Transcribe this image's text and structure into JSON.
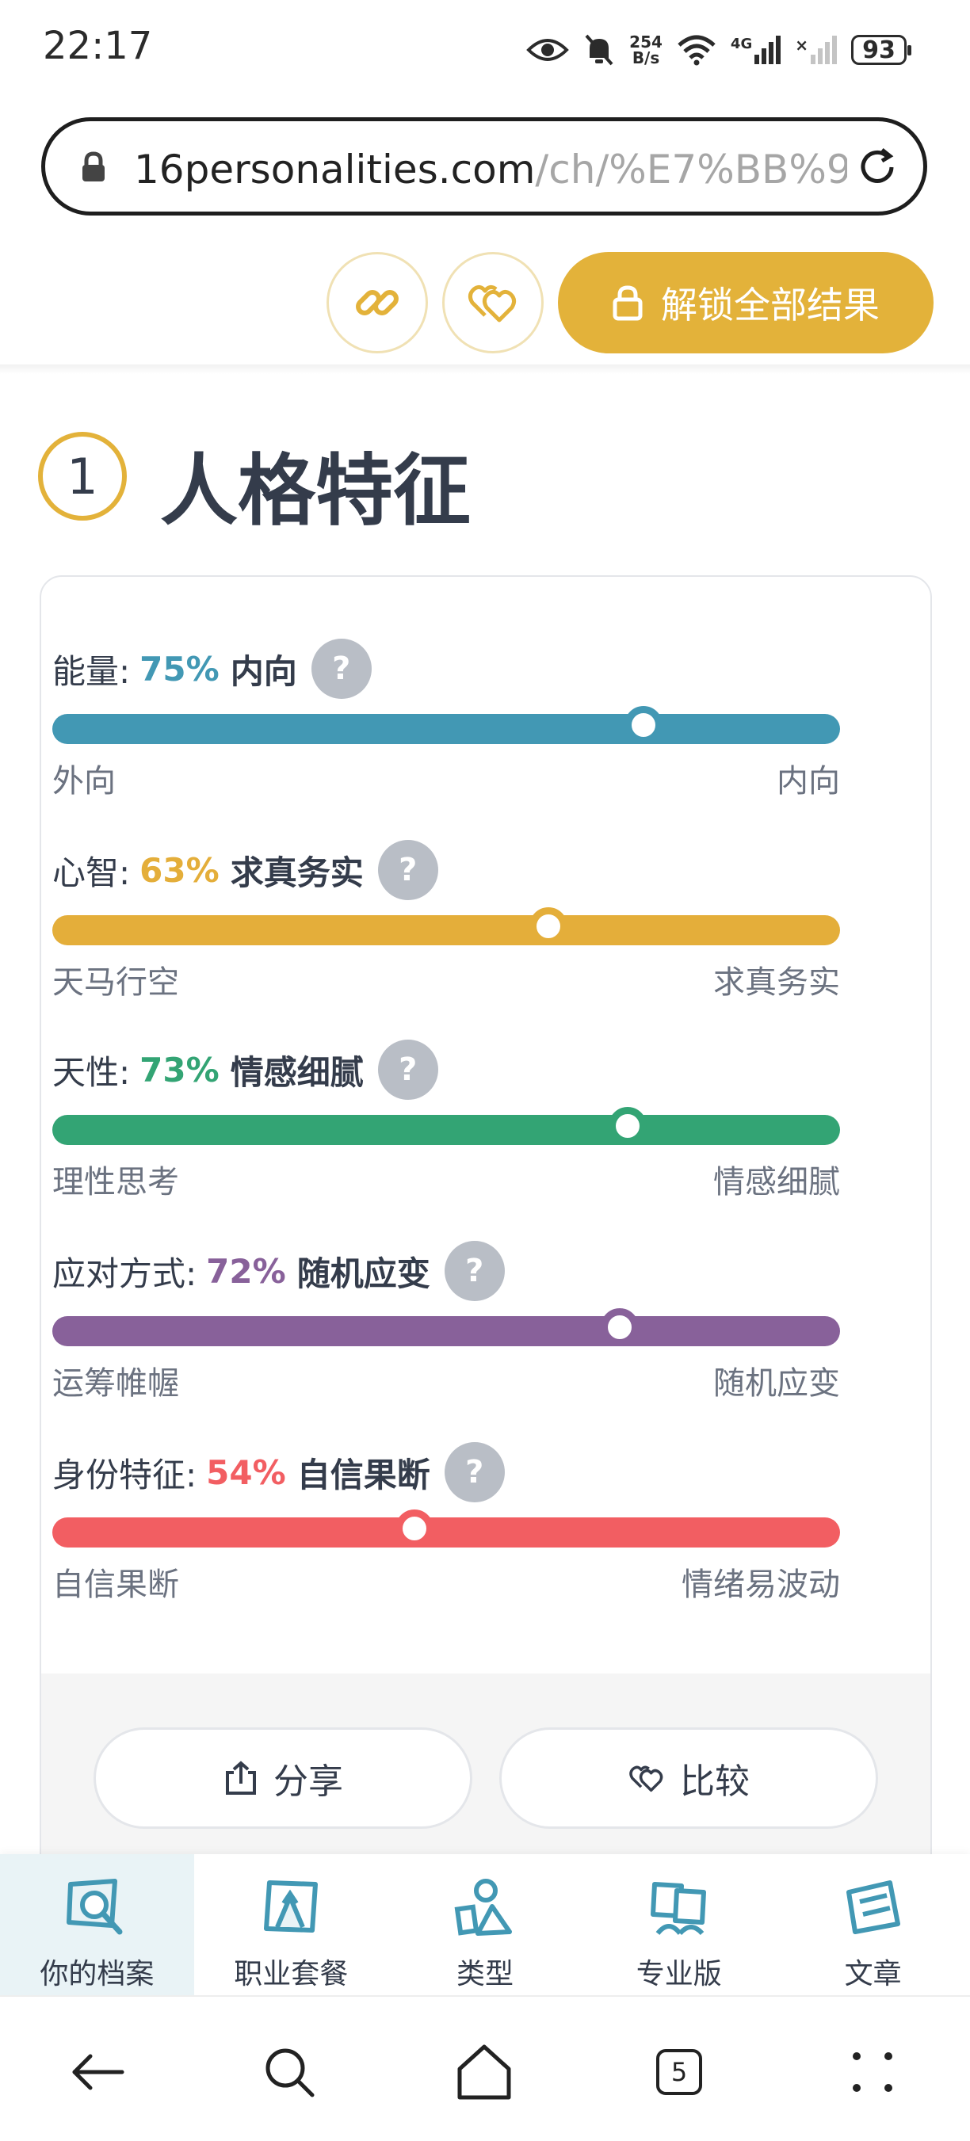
{
  "status_bar": {
    "time": "22:17",
    "net_speed_value": "254",
    "net_speed_unit": "B/s",
    "mobile": "4G",
    "battery": "93"
  },
  "browser": {
    "url_host": "16personalities.com",
    "url_path": "/ch/%E7%BB%9"
  },
  "actions": {
    "unlock_label": "解锁全部结果"
  },
  "section": {
    "number": "1",
    "title": "人格特征"
  },
  "traits": [
    {
      "name": "能量:",
      "percent_text": "75%",
      "percent": 75,
      "result": "内向",
      "left": "外向",
      "right": "内向",
      "color": "#4298b4"
    },
    {
      "name": "心智:",
      "percent_text": "63%",
      "percent": 63,
      "result": "求真务实",
      "left": "天马行空",
      "right": "求真务实",
      "color": "#e4ae3a"
    },
    {
      "name": "天性:",
      "percent_text": "73%",
      "percent": 73,
      "result": "情感细腻",
      "left": "理性思考",
      "right": "情感细腻",
      "color": "#33a474"
    },
    {
      "name": "应对方式:",
      "percent_text": "72%",
      "percent": 72,
      "result": "随机应变",
      "left": "运筹帷幄",
      "right": "随机应变",
      "color": "#88619a"
    },
    {
      "name": "身份特征:",
      "percent_text": "54%",
      "percent": 54,
      "result": "自信果断",
      "left": "自信果断",
      "right": "情绪易波动",
      "color": "#f25e62"
    }
  ],
  "help_glyph": "?",
  "buttons": {
    "share": "分享",
    "compare": "比较"
  },
  "bottom_nav": [
    {
      "label": "你的档案",
      "icon": "profile-icon",
      "active": true
    },
    {
      "label": "职业套餐",
      "icon": "career-icon",
      "active": false
    },
    {
      "label": "类型",
      "icon": "types-icon",
      "active": false
    },
    {
      "label": "专业版",
      "icon": "professional-icon",
      "active": false
    },
    {
      "label": "文章",
      "icon": "articles-icon",
      "active": false
    }
  ],
  "system_nav": {
    "tab_count": "5"
  }
}
